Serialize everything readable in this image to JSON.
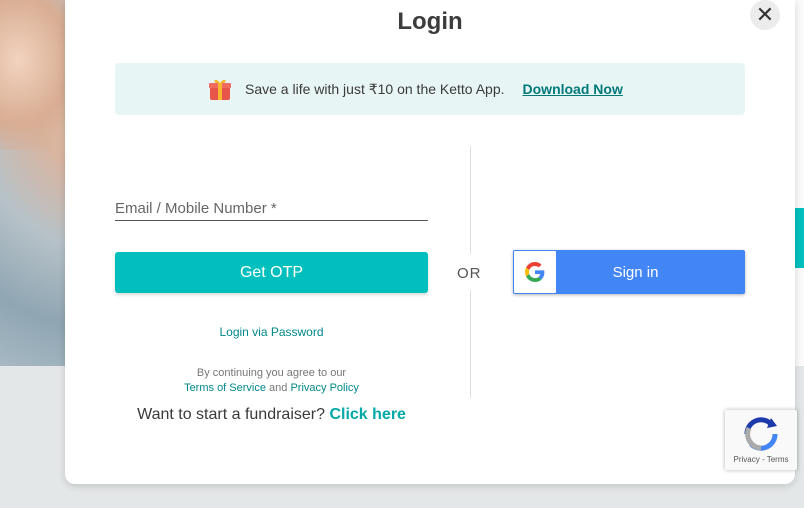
{
  "modal": {
    "title": "Login",
    "close_icon": "close-icon"
  },
  "promo": {
    "icon": "gift-icon",
    "text": "Save a life with just ₹10 on the Ketto App.",
    "link": "Download Now"
  },
  "form": {
    "email_placeholder": "Email / Mobile Number *",
    "otp_button": "Get OTP",
    "password_link": "Login via Password",
    "terms_prefix": "By continuing you agree to our",
    "terms_link": "Terms of Service",
    "terms_and": "and",
    "privacy_link": "Privacy Policy"
  },
  "divider": {
    "or": "OR"
  },
  "google": {
    "label": "Sign in"
  },
  "fundraiser": {
    "prompt": "Want to start a fundraiser?",
    "link": "Click here"
  },
  "recaptcha": {
    "links": "Privacy - Terms"
  },
  "colors": {
    "accent": "#01bfbd",
    "link": "#00888a",
    "google_blue": "#4285f4"
  }
}
